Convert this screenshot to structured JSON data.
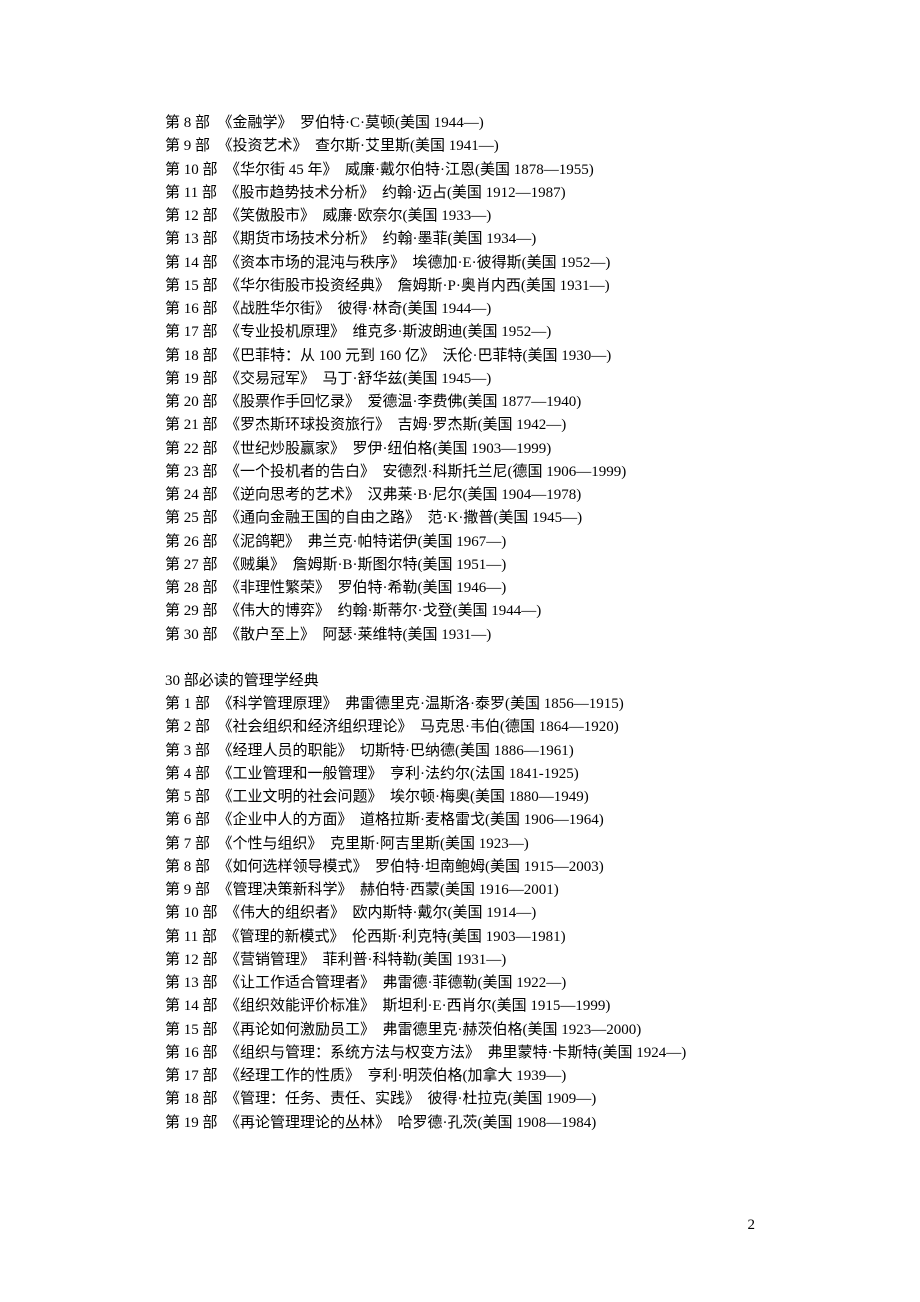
{
  "sections": [
    {
      "title": null,
      "entries": [
        "第 8 部　《金融学》　罗伯特·C·莫顿(美国 1944—)",
        "第 9 部　《投资艺术》　查尔斯·艾里斯(美国 1941—)",
        "第 10 部　《华尔街 45 年》　威廉·戴尔伯特·江恩(美国 1878—1955)",
        "第 11 部　《股市趋势技术分析》　约翰·迈占(美国 1912—1987)",
        "第 12 部　《笑傲股市》　威廉·欧奈尔(美国 1933—)",
        "第 13 部　《期货市场技术分析》　约翰·墨菲(美国 1934—)",
        "第 14 部　《资本市场的混沌与秩序》　埃德加·E·彼得斯(美国 1952—)",
        "第 15 部　《华尔街股市投资经典》　詹姆斯·P·奥肖内西(美国 1931—)",
        "第 16 部　《战胜华尔街》　彼得·林奇(美国 1944—)",
        "第 17 部　《专业投机原理》　维克多·斯波朗迪(美国 1952—)",
        "第 18 部　《巴菲特：从 100 元到 160 亿》　沃伦·巴菲特(美国 1930—)",
        "第 19 部　《交易冠军》　马丁·舒华兹(美国 1945—)",
        "第 20 部　《股票作手回忆录》　爱德温·李费佛(美国 1877—1940)",
        "第 21 部　《罗杰斯环球投资旅行》　吉姆·罗杰斯(美国 1942—)",
        "第 22 部　《世纪炒股赢家》　罗伊·纽伯格(美国 1903—1999)",
        "第 23 部　《一个投机者的告白》　安德烈·科斯托兰尼(德国 1906—1999)",
        "第 24 部　《逆向思考的艺术》　汉弗莱·B·尼尔(美国 1904—1978)",
        "第 25 部　《通向金融王国的自由之路》　范·K·撒普(美国 1945—)",
        "第 26 部　《泥鸽靶》　弗兰克·帕特诺伊(美国 1967—)",
        "第 27 部　《贼巢》　詹姆斯·B·斯图尔特(美国 1951—)",
        "第 28 部　《非理性繁荣》　罗伯特·希勒(美国 1946—)",
        "第 29 部　《伟大的博弈》　约翰·斯蒂尔·戈登(美国 1944—)",
        "第 30 部　《散户至上》　阿瑟·莱维特(美国 1931—)"
      ]
    },
    {
      "title": "30 部必读的管理学经典",
      "entries": [
        "第 1 部　《科学管理原理》　弗雷德里克·温斯洛·泰罗(美国 1856—1915)",
        "第 2 部　《社会组织和经济组织理论》　马克思·韦伯(德国 1864—1920)",
        "第 3 部　《经理人员的职能》　切斯特·巴纳德(美国 1886—1961)",
        "第 4 部　《工业管理和一般管理》　亨利·法约尔(法国 1841-1925)",
        "第 5 部　《工业文明的社会问题》　埃尔顿·梅奥(美国 1880—1949)",
        "第 6 部　《企业中人的方面》　道格拉斯·麦格雷戈(美国 1906—1964)",
        "第 7 部　《个性与组织》　克里斯·阿吉里斯(美国 1923—)",
        "第 8 部　《如何选样领导模式》　罗伯特·坦南鲍姆(美国 1915—2003)",
        "第 9 部　《管理决策新科学》　赫伯特·西蒙(美国 1916—2001)",
        "第 10 部　《伟大的组织者》　欧内斯特·戴尔(美国 1914—)",
        "第 11 部　《管理的新模式》　伦西斯·利克特(美国 1903—1981)",
        "第 12 部　《营销管理》　菲利普·科特勒(美国 1931—)",
        "第 13 部　《让工作适合管理者》　弗雷德·菲德勒(美国 1922—)",
        "第 14 部　《组织效能评价标准》　斯坦利·E·西肖尔(美国 1915—1999)",
        "第 15 部　《再论如何激励员工》　弗雷德里克·赫茨伯格(美国 1923—2000)",
        "第 16 部　《组织与管理：系统方法与权变方法》　弗里蒙特·卡斯特(美国 1924—)",
        "第 17 部　《经理工作的性质》　亨利·明茨伯格(加拿大 1939—)",
        "第 18 部　《管理：任务、责任、实践》　彼得·杜拉克(美国 1909—)",
        "第 19 部　《再论管理理论的丛林》　哈罗德·孔茨(美国 1908—1984)"
      ]
    }
  ],
  "pageNumber": "2"
}
